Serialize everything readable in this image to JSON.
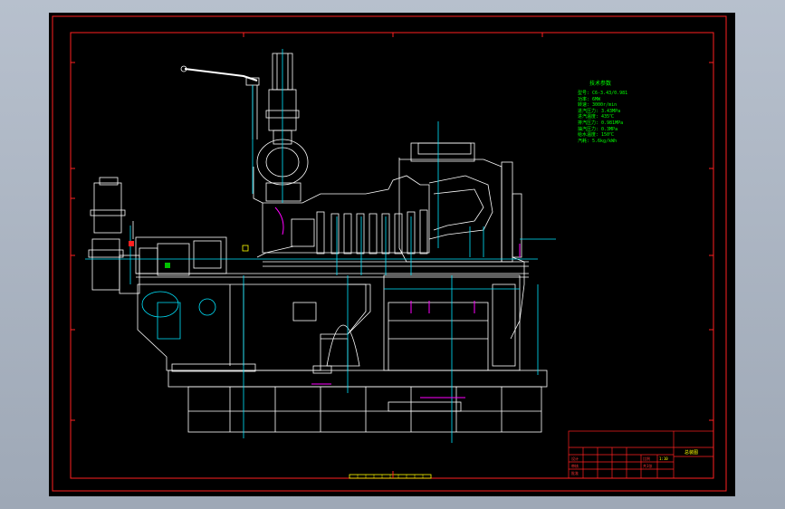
{
  "spec_block": {
    "title": "技术参数",
    "lines": [
      "型号:   C6-3.43/0.981",
      "功率:   6MW",
      "转速:   3000r/min",
      "进汽压力: 3.43MPa",
      "进汽温度: 435℃",
      "排汽压力: 0.981MPa",
      "抽汽压力: 0.3MPa",
      "给水温度: 150℃",
      "汽耗:   5.6kg/kWh"
    ]
  },
  "title_block": {
    "drawing_title": "总装图",
    "scale_label": "比例",
    "scale_value": "1:10",
    "sheet_label": "共1张",
    "designer_label": "设计",
    "checker_label": "审核",
    "approver_label": "批准"
  },
  "colors": {
    "border_red": "#ff2020",
    "line_white": "#ffffff",
    "line_cyan": "#00e5ff",
    "line_magenta": "#ff00ff",
    "line_green": "#00ff00",
    "line_yellow": "#ffff00"
  }
}
